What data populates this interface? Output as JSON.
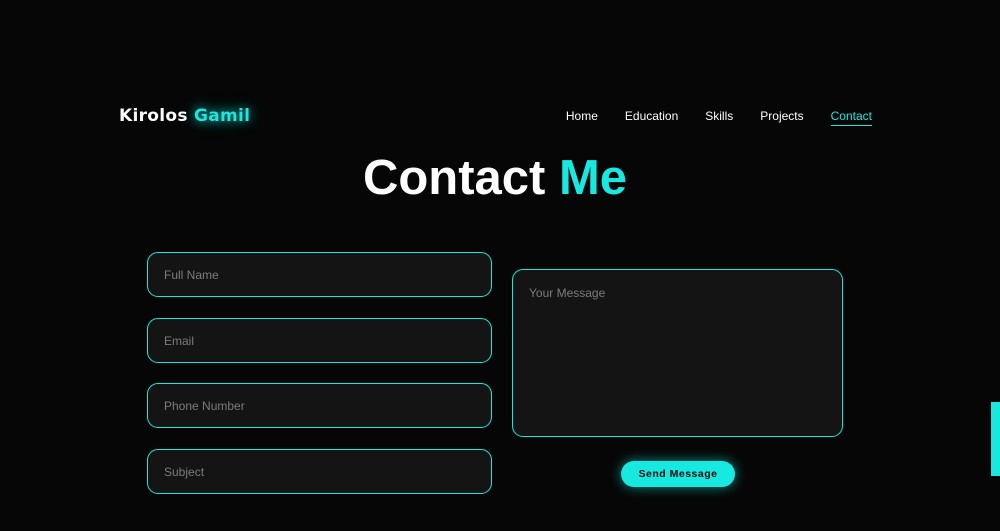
{
  "brand": {
    "first": "Kirolos",
    "last": "Gamil"
  },
  "nav": {
    "items": [
      {
        "label": "Home"
      },
      {
        "label": "Education"
      },
      {
        "label": "Skills"
      },
      {
        "label": "Projects"
      },
      {
        "label": "Contact",
        "active": true
      }
    ]
  },
  "heading": {
    "first": "Contact",
    "accent": "Me"
  },
  "form": {
    "full_name_placeholder": "Full Name",
    "email_placeholder": "Email",
    "phone_placeholder": "Phone Number",
    "subject_placeholder": "Subject",
    "message_placeholder": "Your Message",
    "submit_label": "Send Message"
  },
  "colors": {
    "accent": "#17e9e0",
    "background": "#060606",
    "field_background": "#141414"
  }
}
